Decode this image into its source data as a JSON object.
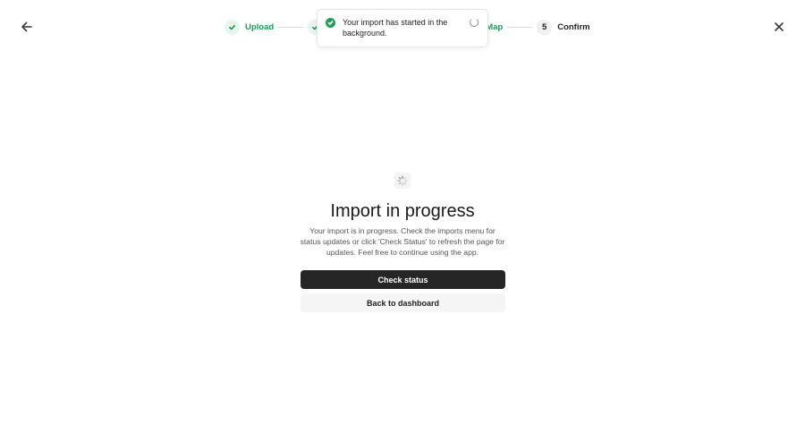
{
  "header": {
    "back_icon": "arrow-left-icon",
    "close_icon": "close-icon"
  },
  "stepper": {
    "steps": [
      {
        "label": "Upload",
        "state": "complete"
      },
      {
        "label": "",
        "state": "complete"
      },
      {
        "label": "Map",
        "state": "complete"
      },
      {
        "number": "5",
        "label": "Confirm",
        "state": "pending"
      }
    ],
    "complete_color": "#1e9b55"
  },
  "toast": {
    "message": "Your import has started in the background.",
    "icon": "check-circle-icon",
    "status_icon": "spinner-icon",
    "accent": "#1f9d55"
  },
  "main": {
    "loader_icon": "loading-spinner-icon",
    "title": "Import in progress",
    "description": "Your import is in progress. Check the imports menu for status updates or click 'Check Status' to refresh the page for updates. Feel free to continue using the app.",
    "primary_button": "Check status",
    "secondary_button": "Back to dashboard"
  }
}
